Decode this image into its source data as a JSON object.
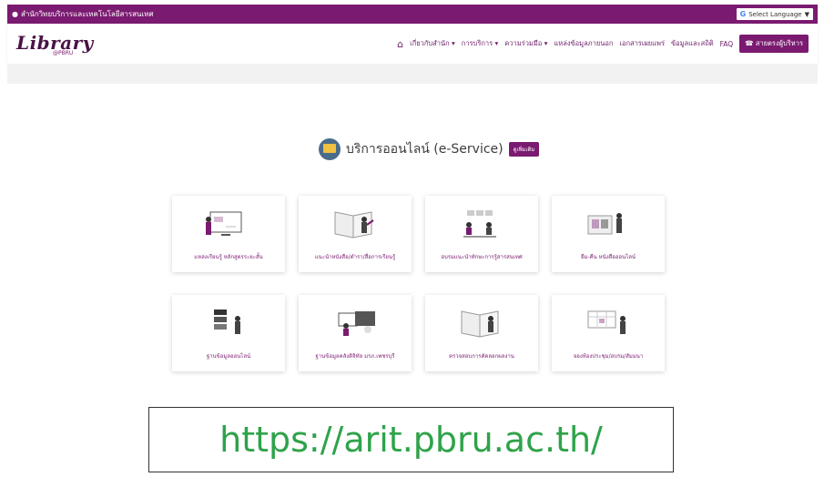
{
  "topbar": {
    "org_name": "สำนักวิทยบริการและเทคโนโลยีสารสนเทศ",
    "language_label": "Select Language",
    "language_arrow": "▼"
  },
  "header": {
    "logo_text": "Library",
    "logo_sub": "@PBRU",
    "nav": [
      "เกี่ยวกับสำนัก ▾",
      "การบริการ ▾",
      "ความร่วมมือ ▾",
      "แหล่งข้อมูลภายนอก",
      "เอกสารเผยแพร่",
      "ข้อมูลและสถิติ",
      "FAQ"
    ],
    "cta_label": "สายตรงผู้บริหาร"
  },
  "section": {
    "title": "บริการออนไลน์ (e-Service)",
    "more_label": "ดูเพิ่มเติม"
  },
  "services": [
    {
      "label": "แหล่งเรียนรู้ หลักสูตรระยะสั้น",
      "icon": "computer-learning-icon"
    },
    {
      "label": "แนะนำหนังสือ/ตำรา/สื่อการเรียนรู้",
      "icon": "book-recommend-icon"
    },
    {
      "label": "อบรมแนะนำทักษะการรู้สารสนเทศ",
      "icon": "training-icon"
    },
    {
      "label": "ยืม-คืน หนังสือออนไลน์",
      "icon": "borrow-return-icon"
    },
    {
      "label": "ฐานข้อมูลออนไลน์",
      "icon": "database-icon"
    },
    {
      "label": "ฐานข้อมูลคลังดิจิทัล มรภ.เพชรบุรี",
      "icon": "digital-archive-icon"
    },
    {
      "label": "ตรวจสอบการคัดลอกผลงาน",
      "icon": "plagiarism-check-icon"
    },
    {
      "label": "จองห้องประชุม/อบรม/สัมมนา",
      "icon": "room-booking-icon"
    }
  ],
  "url_caption": "https://arit.pbru.ac.th/",
  "colors": {
    "brand": "#7a1a70",
    "url_green": "#2ea34a"
  }
}
